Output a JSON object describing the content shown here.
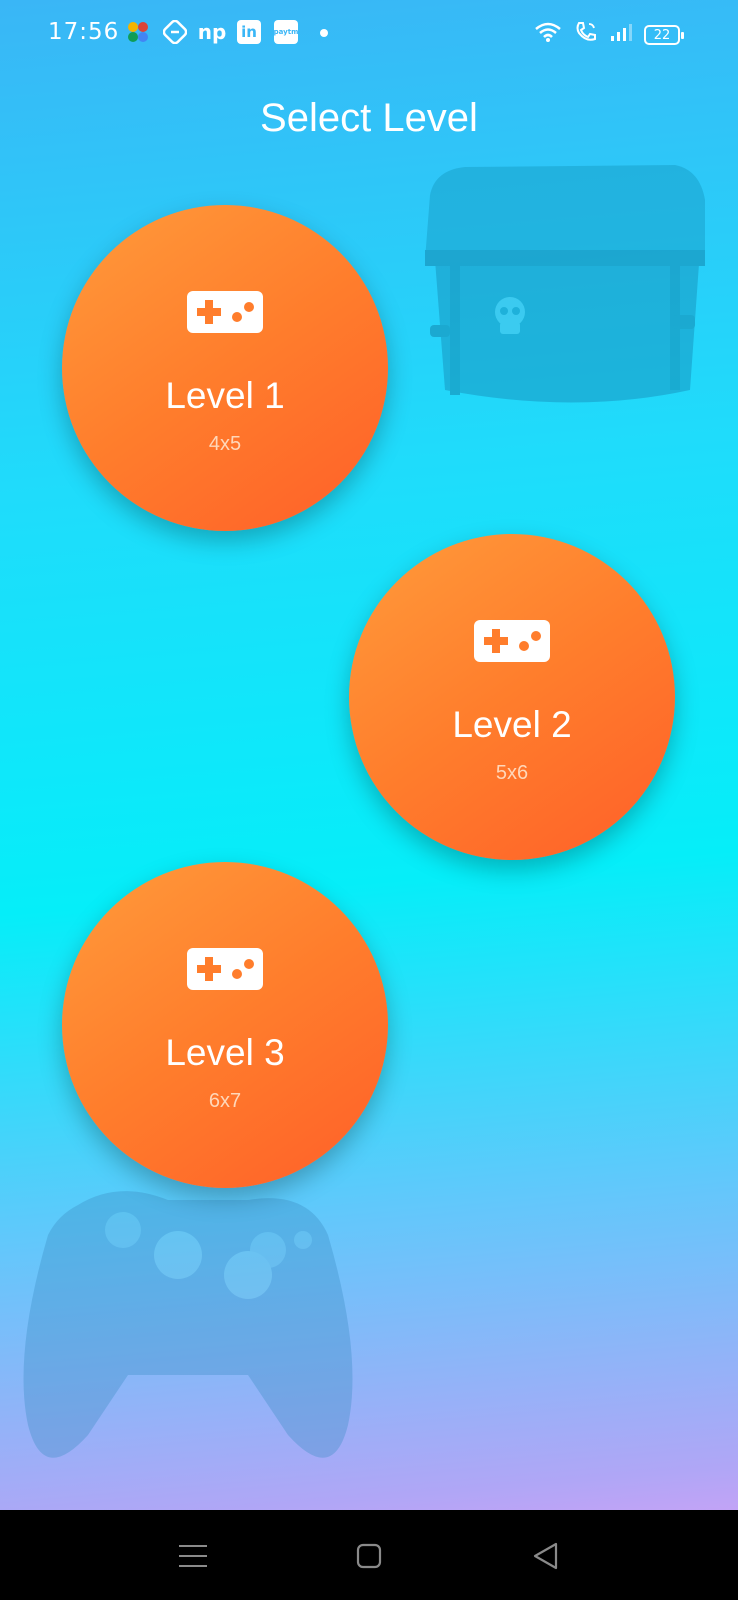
{
  "status_bar": {
    "time": "17:56",
    "battery": "22",
    "app_icons": [
      "photos-icon",
      "shield-app-icon",
      "np-app-icon",
      "linkedin-icon",
      "paytm-icon"
    ],
    "np_label": "np",
    "linkedin_label": "in",
    "paytm_label": "paytm"
  },
  "title": "Select Level",
  "levels": [
    {
      "name": "Level 1",
      "size": "4x5"
    },
    {
      "name": "Level 2",
      "size": "5x6"
    },
    {
      "name": "Level 3",
      "size": "6x7"
    }
  ],
  "colors": {
    "button_orange": "#ff7d2c",
    "background_cyan": "#05eef9",
    "background_pink": "#e79df7"
  },
  "nav": {
    "icons": [
      "menu-icon",
      "home-icon",
      "back-icon"
    ]
  }
}
